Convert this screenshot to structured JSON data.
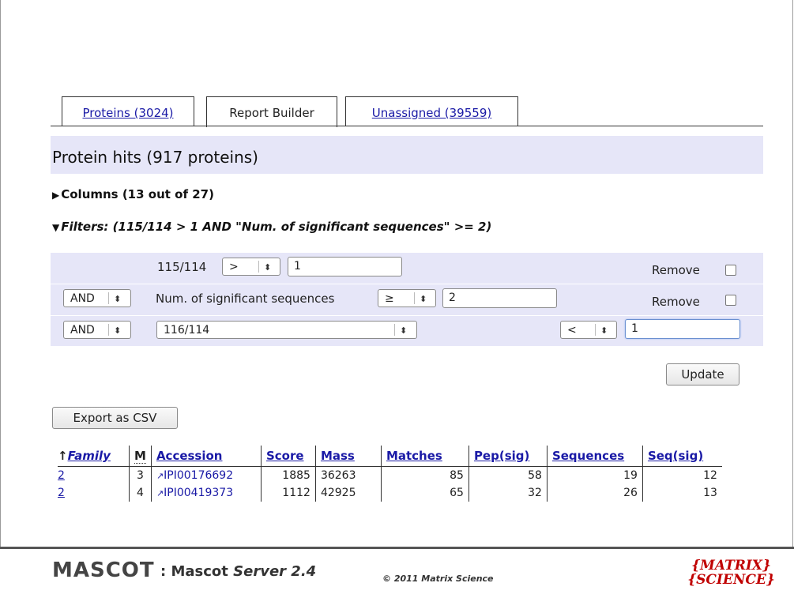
{
  "tabs": [
    {
      "label": "Proteins (3024)"
    },
    {
      "label": "Report Builder"
    },
    {
      "label": "Unassigned (39559)"
    }
  ],
  "page_title": "Protein hits (917 proteins)",
  "columns_toggle": "Columns (13 out of 27)",
  "filters_toggle": "Filters: (115/114 > 1 AND \"Num. of significant sequences\" >= 2)",
  "filters": [
    {
      "field": "115/114",
      "operator": ">",
      "value": "1",
      "remove_label": "Remove"
    },
    {
      "conjunction": "AND",
      "field": "Num. of significant sequences",
      "operator": "≥",
      "value": "2",
      "remove_label": "Remove"
    },
    {
      "conjunction": "AND",
      "field": "116/114",
      "operator": "<",
      "value": "1"
    }
  ],
  "update_label": "Update",
  "export_label": "Export as CSV",
  "table": {
    "headers": {
      "family": "Family",
      "m": "M",
      "accession": "Accession",
      "score": "Score",
      "mass": "Mass",
      "matches": "Matches",
      "pep_sig": "Pep(sig)",
      "sequences": "Sequences",
      "seq_sig": "Seq(sig)"
    },
    "sort_arrow": "↑",
    "rows": [
      {
        "family": "2",
        "m": "3",
        "accession": "IPI00176692",
        "score": "1885",
        "mass": "36263",
        "matches": "85",
        "pep_sig": "58",
        "sequences": "19",
        "seq_sig": "12"
      },
      {
        "family": "2",
        "m": "4",
        "accession": "IPI00419373",
        "score": "1112",
        "mass": "42925",
        "matches": "65",
        "pep_sig": "32",
        "sequences": "26",
        "seq_sig": "13"
      }
    ]
  },
  "footer": {
    "logo": "MASCOT",
    "version_prefix": ": Mascot",
    "version_italic": "Server 2.4",
    "copyright": "© 2011 Matrix Science",
    "ms_logo_line1": "{MATRIX}",
    "ms_logo_line2": "{SCIENCE}"
  },
  "colors": {
    "link": "#1a1aa6",
    "band": "#e6e6f8",
    "logo_red": "#c00000"
  }
}
